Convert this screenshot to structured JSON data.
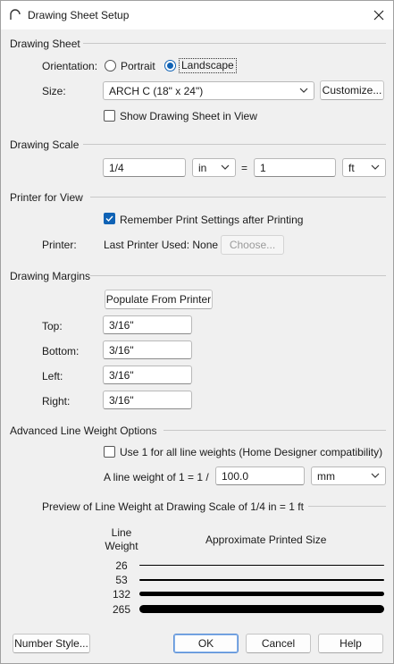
{
  "window": {
    "title": "Drawing Sheet Setup"
  },
  "drawing_sheet": {
    "heading": "Drawing Sheet",
    "orientation_label": "Orientation:",
    "portrait_label": "Portrait",
    "landscape_label": "Landscape",
    "orientation_selected": "Landscape",
    "size_label": "Size:",
    "size_value": "ARCH C  (18\" x 24\")",
    "customize_label": "Customize...",
    "show_sheet_label": "Show Drawing Sheet in View",
    "show_sheet_checked": false
  },
  "drawing_scale": {
    "heading": "Drawing Scale",
    "left_value": "1/4",
    "left_unit": "in",
    "equals": "=",
    "right_value": "1",
    "right_unit": "ft"
  },
  "printer": {
    "heading": "Printer for View",
    "remember_label": "Remember Print Settings after Printing",
    "remember_checked": true,
    "printer_label": "Printer:",
    "printer_value": "Last Printer Used: None",
    "choose_label": "Choose..."
  },
  "margins": {
    "heading": "Drawing Margins",
    "populate_label": "Populate From Printer",
    "top_label": "Top:",
    "top_value": "3/16\"",
    "bottom_label": "Bottom:",
    "bottom_value": "3/16\"",
    "left_label": "Left:",
    "left_value": "3/16\"",
    "right_label": "Right:",
    "right_value": "3/16\""
  },
  "line_weight": {
    "heading": "Advanced Line Weight Options",
    "use1_label": "Use 1 for all line weights (Home Designer compatibility)",
    "use1_checked": false,
    "weight_label": "A line weight of 1 = 1 /",
    "weight_value": "100.0",
    "weight_unit": "mm",
    "preview_heading": "Preview of Line Weight at Drawing Scale of  1/4 in = 1 ft",
    "col_line": "Line",
    "col_weight": "Weight",
    "col_size": "Approximate Printed Size",
    "rows": [
      "26",
      "53",
      "132",
      "265"
    ]
  },
  "footer": {
    "number_style_label": "Number Style...",
    "ok_label": "OK",
    "cancel_label": "Cancel",
    "help_label": "Help"
  }
}
